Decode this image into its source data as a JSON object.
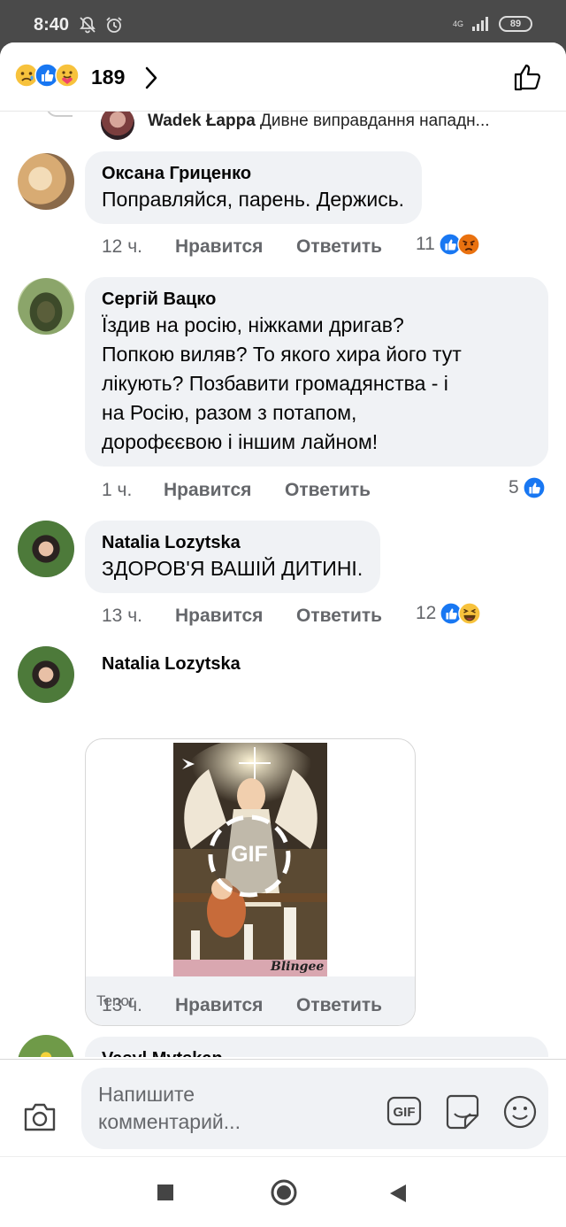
{
  "status_bar": {
    "time": "8:40",
    "network": "4G",
    "battery": "89"
  },
  "header": {
    "reaction_icons": [
      "sad-reaction-icon",
      "like-reaction-icon",
      "care-reaction-icon"
    ],
    "reaction_count": "189"
  },
  "reply_preview": {
    "author": "Wadek Łappa",
    "text": "Дивне виправдання нападн..."
  },
  "comments": [
    {
      "author": "Оксана Гриценко",
      "text": "Поправляйся, парень. Держись.",
      "time": "12 ч.",
      "like_label": "Нравится",
      "reply_label": "Ответить",
      "reaction_count": "11",
      "reactions": [
        "like-reaction-icon",
        "angry-reaction-icon"
      ]
    },
    {
      "author": "Сергій Вацко",
      "text": "Їздив на росію, ніжками дригав?\nПопкою виляв? То якого хира його тут\nлікують? Позбавити громадянства - і\nна Росію, разом з потапом,\nдорофєєвою і іншим лайном!",
      "time": "1 ч.",
      "like_label": "Нравится",
      "reply_label": "Ответить",
      "reaction_count": "5",
      "reactions": [
        "like-reaction-icon"
      ]
    },
    {
      "author": "Natalia Lozytska",
      "text": "ЗДОРОВ'Я ВАШІЙ ДИТИНІ.",
      "time": "13 ч.",
      "like_label": "Нравится",
      "reply_label": "Ответить",
      "reaction_count": "12",
      "reactions": [
        "like-reaction-icon",
        "haha-reaction-icon"
      ]
    },
    {
      "author": "Natalia Lozytska",
      "gif_badge": "GIF",
      "gif_watermark": "Blingee",
      "gif_source": "Tenor",
      "time": "13 ч.",
      "like_label": "Нравится",
      "reply_label": "Ответить"
    },
    {
      "author": "Vasyl Mytskan"
    }
  ],
  "composer": {
    "placeholder": "Напишите комментарий...",
    "gif_button": "GIF"
  },
  "colors": {
    "like_blue": "#1877f2",
    "bubble_bg": "#f0f2f5",
    "secondary_text": "#65676b"
  }
}
